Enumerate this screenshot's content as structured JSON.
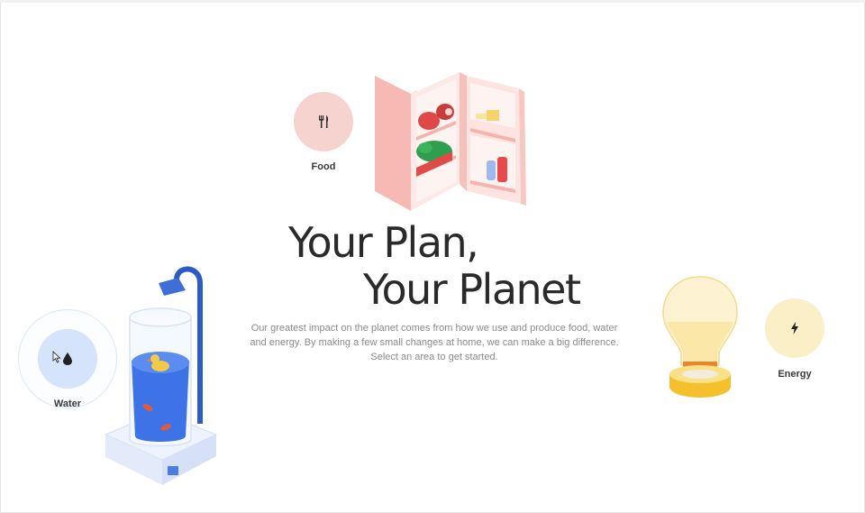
{
  "hero": {
    "title_line1": "Your Plan,",
    "title_line2": "Your Planet",
    "description": "Our greatest impact on the planet comes from how we use and produce food, water and energy. By making a few small changes at home, we can make a big difference. Select an area to get started."
  },
  "categories": {
    "food": {
      "label": "Food",
      "icon": "fork-knife-icon",
      "color": "#f7d3cf"
    },
    "water": {
      "label": "Water",
      "icon": "water-drop-icon",
      "color": "#d5e3fb"
    },
    "energy": {
      "label": "Energy",
      "icon": "lightning-bolt-icon",
      "color": "#fbefc8"
    }
  }
}
